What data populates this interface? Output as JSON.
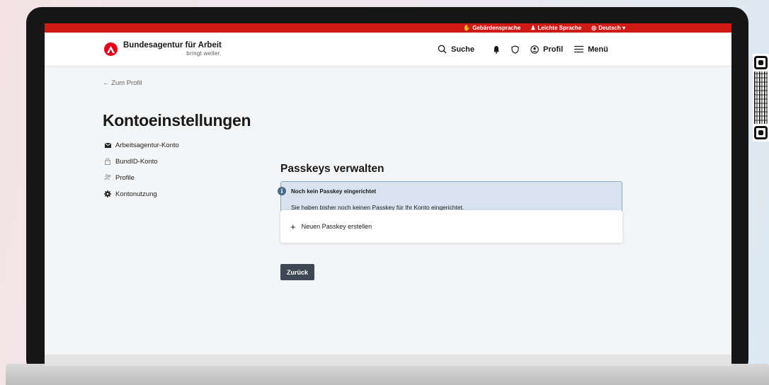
{
  "topbar": {
    "items": [
      {
        "icon": "sign-language-icon",
        "glyph": "✋",
        "label": "Gebärdensprache"
      },
      {
        "icon": "easy-language-icon",
        "glyph": "♟",
        "label": "Leichte Sprache"
      },
      {
        "icon": "globe-icon",
        "glyph": "◎",
        "label": "Deutsch ▾"
      }
    ]
  },
  "header": {
    "logo_name": "Bundesagentur für Arbeit",
    "logo_tagline": "bringt weiter.",
    "search_label": "Suche",
    "profile_label": "Profil",
    "menu_label": "Menü"
  },
  "back_link": "← Zum Profil",
  "page_title": "Kontoeinstellungen",
  "sidebar": {
    "items": [
      {
        "icon": "envelope-icon",
        "label": "Arbeitsagentur-Konto"
      },
      {
        "icon": "lock-icon",
        "label": "BundID-Konto"
      },
      {
        "icon": "people-icon",
        "label": "Profile"
      },
      {
        "icon": "gear-icon",
        "label": "Kontonutzung"
      }
    ]
  },
  "main": {
    "section_title": "Passkeys verwalten",
    "info_title": "Noch kein Passkey eingerichtet",
    "info_text": "Sie haben bisher noch keinen Passkey für Ihr Konto eingerichtet.",
    "create_label": "Neuen Passkey erstellen",
    "back_button": "Zurück"
  },
  "colors": {
    "brand_red": "#cf1a16",
    "info_bg": "#d8e3ef",
    "button_dark": "#3e4854"
  }
}
